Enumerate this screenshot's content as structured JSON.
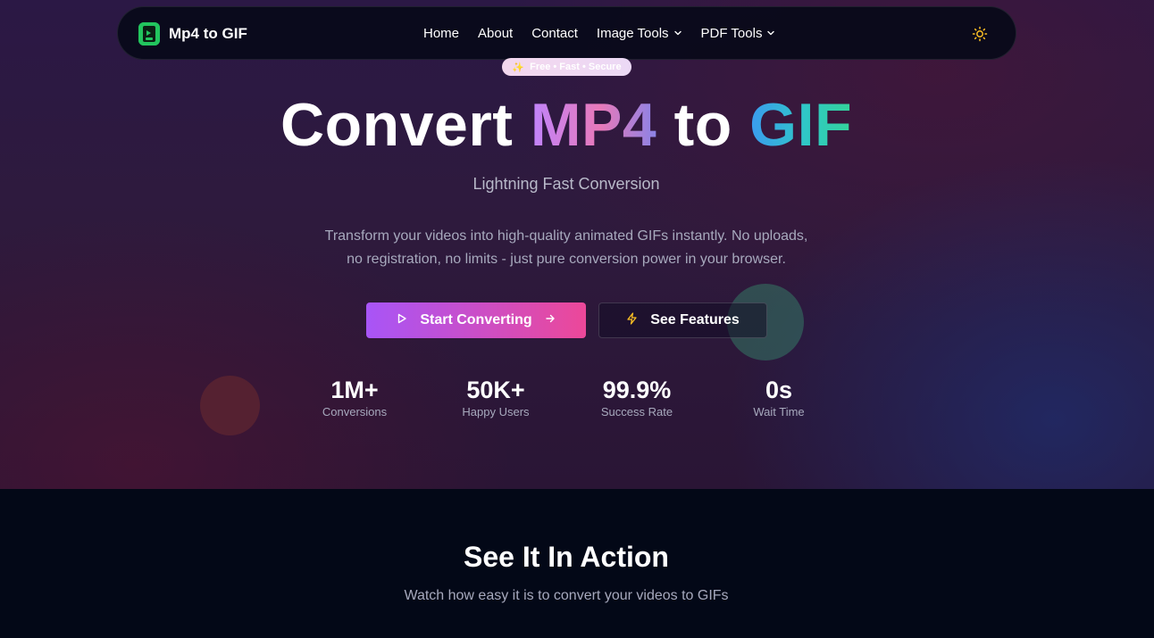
{
  "nav": {
    "brand": "Mp4 to GIF",
    "links": [
      {
        "label": "Home"
      },
      {
        "label": "About"
      },
      {
        "label": "Contact"
      },
      {
        "label": "Image Tools"
      },
      {
        "label": "PDF Tools"
      }
    ]
  },
  "hero": {
    "badge": "Free • Fast • Secure",
    "title_parts": [
      "Convert",
      "MP4",
      "to",
      "GIF"
    ],
    "subtitle": "Lightning Fast Conversion",
    "description_line1": "Transform your videos into high-quality animated GIFs instantly. No uploads,",
    "description_line2": "no registration, no limits - just pure conversion power in your browser.",
    "primary_button": "Start Converting",
    "secondary_button": "See Features",
    "stats": [
      {
        "value": "1M+",
        "label": "Conversions"
      },
      {
        "value": "50K+",
        "label": "Happy Users"
      },
      {
        "value": "99.9%",
        "label": "Success Rate"
      },
      {
        "value": "0s",
        "label": "Wait Time"
      }
    ]
  },
  "action_section": {
    "title": "See It In Action",
    "subtitle": "Watch how easy it is to convert your videos to GIFs"
  },
  "colors": {
    "brand_green": "#22c55e",
    "button_gradient_start": "#a855f7",
    "button_gradient_end": "#ec4899",
    "sun_icon": "#fbbf24"
  },
  "icons": {
    "logo": "file-video-icon",
    "theme": "sun-icon",
    "badge": "sparkles-icon",
    "play": "play-icon",
    "arrow": "arrow-right-icon",
    "bolt": "lightning-icon"
  }
}
